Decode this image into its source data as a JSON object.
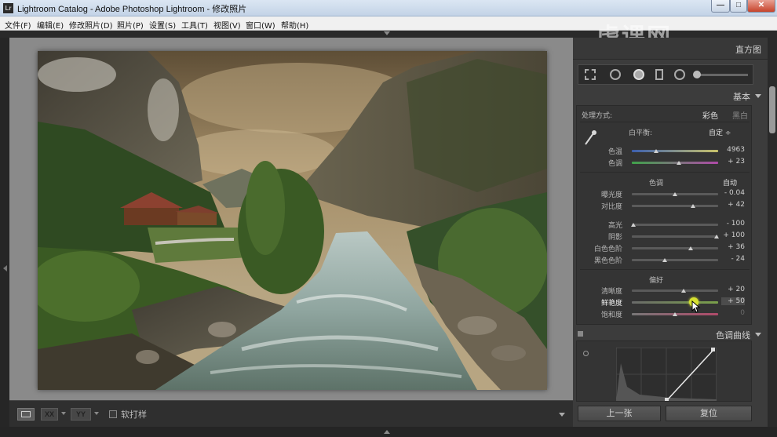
{
  "window": {
    "title": "Lightroom Catalog - Adobe Photoshop Lightroom - 修改照片",
    "app_icon": "Lr",
    "controls": {
      "minimize": "—",
      "maximize": "□",
      "close": "✕"
    }
  },
  "menu": [
    "文件(F)",
    "编辑(E)",
    "修改照片(D)",
    "照片(P)",
    "设置(S)",
    "工具(T)",
    "视图(V)",
    "窗口(W)",
    "帮助(H)"
  ],
  "watermark": "虎课网",
  "toolbar": {
    "view_buttons": [
      "",
      "XX",
      "YY"
    ],
    "softproof_label": "软打样"
  },
  "panel": {
    "histogram_label": "直方图",
    "basic_label": "基本",
    "treatment_label": "处理方式:",
    "treatment_color": "彩色",
    "treatment_bw": "黑白",
    "wb_label": "白平衡:",
    "wb_value": "自定 ÷",
    "tone_label": "色调",
    "tone_auto": "自动",
    "presence_label": "偏好",
    "curve_label": "色调曲线",
    "sliders": [
      {
        "name": "temp",
        "label": "色温",
        "value": "4963",
        "pos": 0.32
      },
      {
        "name": "tint",
        "label": "色调",
        "value": "+ 23",
        "pos": 0.58
      },
      {
        "name": "exposure",
        "label": "曝光度",
        "value": "- 0.04",
        "pos": 0.5
      },
      {
        "name": "contrast",
        "label": "对比度",
        "value": "+ 42",
        "pos": 0.71
      },
      {
        "name": "highlights",
        "label": "高光",
        "value": "- 100",
        "pos": 0.02
      },
      {
        "name": "shadows",
        "label": "阴影",
        "value": "+ 100",
        "pos": 0.98
      },
      {
        "name": "whites",
        "label": "白色色阶",
        "value": "+ 36",
        "pos": 0.68
      },
      {
        "name": "blacks",
        "label": "黑色色阶",
        "value": "- 24",
        "pos": 0.38
      },
      {
        "name": "clarity",
        "label": "清晰度",
        "value": "+ 20",
        "pos": 0.6
      },
      {
        "name": "vibrance",
        "label": "鲜艳度",
        "value": "+ 50",
        "pos": 0.75
      },
      {
        "name": "saturation",
        "label": "饱和度",
        "value": "0",
        "pos": 0.5
      }
    ],
    "prev_button": "上一张",
    "reset_button": "复位"
  },
  "colors": {
    "panel_bg": "#3c3c3c",
    "center_bg": "#8a8a8a",
    "cursor_highlight": "#d6e030"
  }
}
